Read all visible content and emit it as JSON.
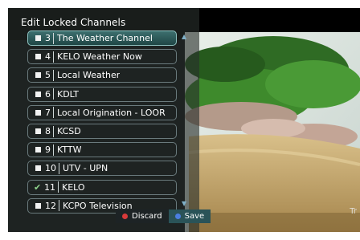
{
  "screen": {
    "title": "Edit Locked Channels",
    "channels": [
      {
        "number": "3",
        "name": "The Weather Channel",
        "locked": false
      },
      {
        "number": "4",
        "name": "KELO Weather Now",
        "locked": false
      },
      {
        "number": "5",
        "name": "Local Weather",
        "locked": false
      },
      {
        "number": "6",
        "name": "KDLT",
        "locked": false
      },
      {
        "number": "7",
        "name": "Local Origination - LOOR",
        "locked": false
      },
      {
        "number": "8",
        "name": "KCSD",
        "locked": false
      },
      {
        "number": "9",
        "name": "KTTW",
        "locked": false
      },
      {
        "number": "10",
        "name": "UTV - UPN",
        "locked": false
      },
      {
        "number": "11",
        "name": "KELO",
        "locked": true
      },
      {
        "number": "12",
        "name": "KCPO Television",
        "locked": false
      }
    ],
    "selected_index": 0,
    "buttons": {
      "discard_label": "Discard",
      "save_label": "Save"
    },
    "video_overlay_text": "Tr",
    "colors": {
      "discard_dot": "#d83a3a",
      "save_dot": "#4b7ee0",
      "check": "#8ed38b",
      "selected_row": "#2e5b5a"
    }
  }
}
